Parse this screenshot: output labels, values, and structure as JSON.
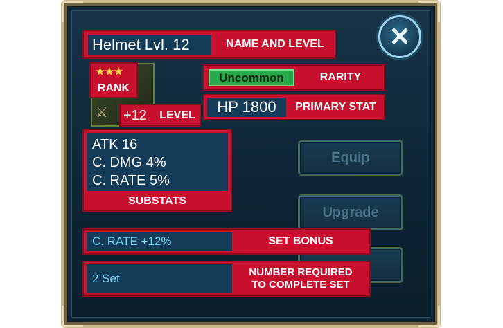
{
  "item": {
    "name": "Helmet Lvl. 12",
    "name_label": "NAME AND LEVEL",
    "stars": "★★★",
    "rank_label": "RANK",
    "level": "+12",
    "level_label": "LEVEL"
  },
  "rarity": {
    "value": "Uncommon",
    "label": "RARITY"
  },
  "primary": {
    "value": "HP 1800",
    "label": "PRIMARY STAT"
  },
  "substats": {
    "lines": [
      "ATK 16",
      "C. DMG 4%",
      "C. RATE 5%"
    ],
    "label": "SUBSTATS"
  },
  "actions": {
    "equip": "Equip",
    "upgrade": "Upgrade"
  },
  "set_bonus": {
    "value": "C. RATE +12%",
    "label": "SET BONUS"
  },
  "set_count": {
    "value": "2 Set",
    "label_line1": "NUMBER REQUIRED",
    "label_line2": "TO COMPLETE SET"
  },
  "close": "✕",
  "colors": {
    "annotation_red": "#c8102e",
    "panel_dark": "#0e2638",
    "uncommon_green": "#27a84a",
    "set_text": "#6fd4f2",
    "frame_gold": "#c9b98a"
  }
}
